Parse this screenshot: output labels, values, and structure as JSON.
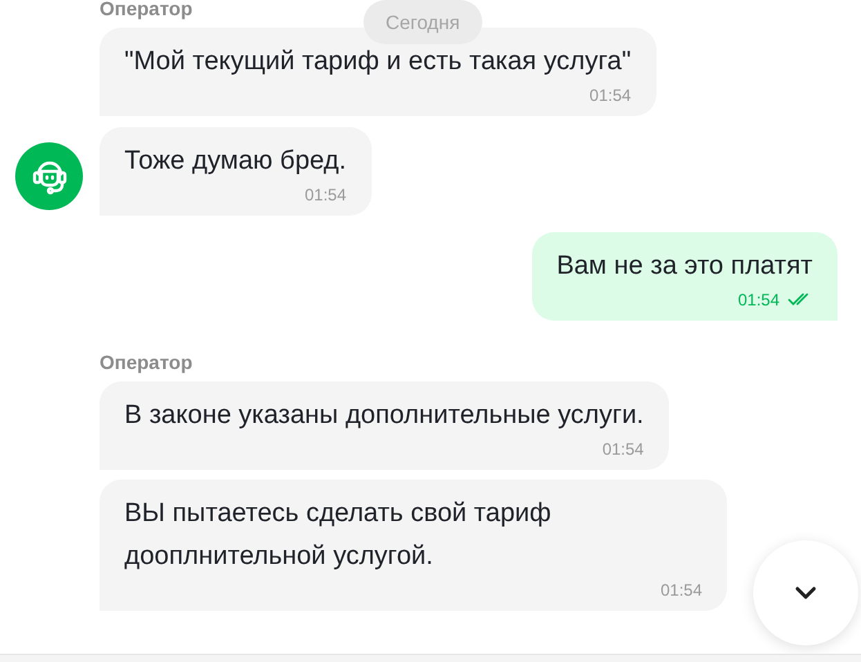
{
  "date_badge": "Сегодня",
  "groups": [
    {
      "kind": "incoming",
      "sender": "Оператор",
      "avatar": false,
      "messages": [
        {
          "text": "\"Мой текущий тариф и есть такая услуга\"",
          "time": "01:54"
        }
      ]
    },
    {
      "kind": "incoming",
      "avatar": true,
      "messages": [
        {
          "text": "Тоже думаю бред.",
          "time": "01:54"
        }
      ]
    },
    {
      "kind": "outgoing",
      "messages": [
        {
          "text": "Вам не за это платят",
          "time": "01:54",
          "read": true
        }
      ]
    },
    {
      "kind": "incoming",
      "sender": "Оператор",
      "avatar": false,
      "messages": [
        {
          "text": "В законе указаны дополнительные услуги.",
          "time": "01:54"
        },
        {
          "text": "ВЫ пытаетесь сделать свой тариф дооплнительной услугой.",
          "time": "01:54"
        }
      ]
    }
  ]
}
